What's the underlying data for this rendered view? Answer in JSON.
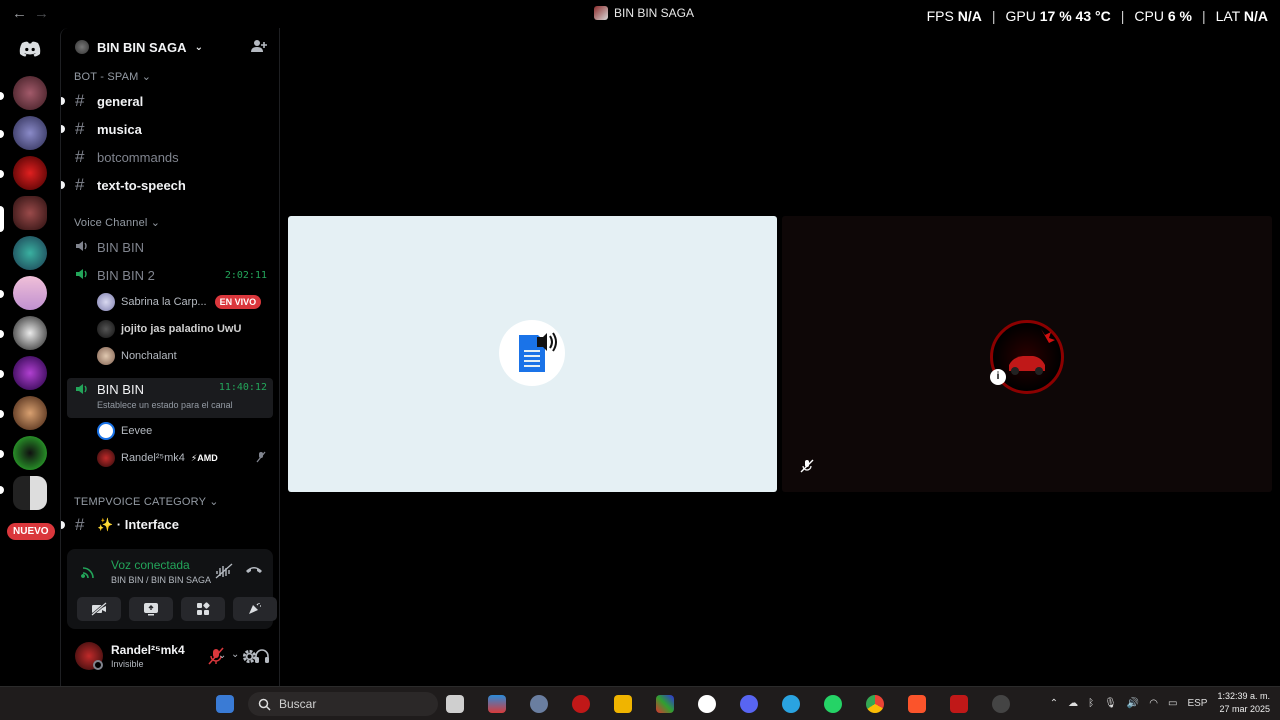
{
  "window": {
    "title": "BIN BIN SAGA"
  },
  "overlay": {
    "fps_label": "FPS",
    "fps_value": "N/A",
    "gpu_label": "GPU",
    "gpu_value": "17 %  43 °C",
    "cpu_label": "CPU",
    "cpu_value": "6 %",
    "lat_label": "LAT",
    "lat_value": "N/A"
  },
  "rail": {
    "new_badge": "NUEVO"
  },
  "guild": {
    "name": "BIN BIN SAGA"
  },
  "categories": {
    "bot_spam": "BOT - SPAM",
    "voice": "Voice Channel",
    "tempvoice": "TEMPVOICE CATEGORY"
  },
  "text_channels": [
    {
      "name": "general"
    },
    {
      "name": "musica"
    },
    {
      "name": "botcommands"
    },
    {
      "name": "text-to-speech"
    }
  ],
  "voice_channels": [
    {
      "name": "BIN BIN"
    },
    {
      "name": "BIN BIN 2",
      "timer": "2:02:11"
    },
    {
      "name": "BIN BIN",
      "timer": "11:40:12",
      "status": "Establece un estado para el canal"
    }
  ],
  "voice_users_bb2": [
    {
      "name": "Sabrina la Carp...",
      "badge": "EN VIVO"
    },
    {
      "name": "jojito jas paladino UwU"
    },
    {
      "name": "Nonchalant"
    }
  ],
  "voice_users_bb": [
    {
      "name": "Eevee"
    },
    {
      "name": "Randel²⁵mk4",
      "badge": "⚡AMD"
    }
  ],
  "tempvoice_channel": {
    "name": "✨ · Interface"
  },
  "voice_panel": {
    "title": "Voz conectada",
    "subtitle": "BIN BIN / BIN BIN SAGA"
  },
  "user": {
    "name": "Randel²⁵mk4",
    "status": "Invisible"
  },
  "taskbar": {
    "search_placeholder": "Buscar",
    "lang": "ESP",
    "time": "1:32:39 a. m.",
    "date": "27 mar 2025"
  },
  "colors": {
    "green": "#23a55a",
    "red": "#da373c",
    "tile_left": "#e5f0f4",
    "tile_right": "#0e0707"
  }
}
